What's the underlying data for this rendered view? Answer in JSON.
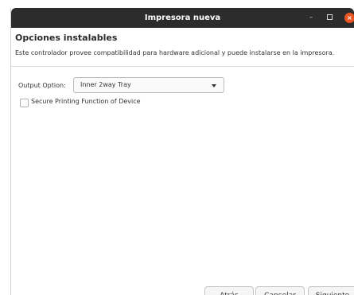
{
  "window": {
    "title": "Impresora nueva",
    "controls": {
      "minimize": "–",
      "close": "×"
    }
  },
  "page": {
    "heading": "Opciones instalables",
    "description": "Este controlador provee compatibilidad para hardware adicional y puede instalarse en la impresora."
  },
  "options": {
    "output_label": "Output Option:",
    "output_value": "Inner 2way Tray",
    "secure_printing_label": "Secure Printing Function of Device",
    "secure_printing_checked": false
  },
  "buttons": {
    "back": "Atrás",
    "cancel": "Cancelar",
    "next": "Siguiente"
  },
  "colors": {
    "titlebar": "#2c2c2c",
    "close_button": "#e95420"
  },
  "icons": {
    "minimize": "minimize-icon",
    "maximize": "maximize-icon",
    "close": "close-icon",
    "dropdown": "chevron-down-icon"
  }
}
